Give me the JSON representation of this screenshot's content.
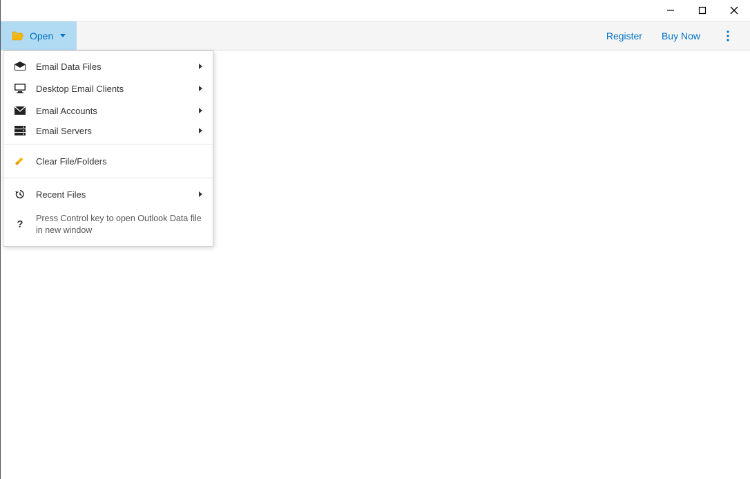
{
  "toolbar": {
    "open_label": "Open",
    "register_label": "Register",
    "buynow_label": "Buy Now"
  },
  "menu": {
    "items": [
      {
        "label": "Email Data Files"
      },
      {
        "label": "Desktop Email Clients"
      },
      {
        "label": "Email Accounts"
      },
      {
        "label": "Email Servers"
      }
    ],
    "clear_label": "Clear File/Folders",
    "recent_label": "Recent Files",
    "hint": "Press Control key to open Outlook Data file in new window"
  }
}
